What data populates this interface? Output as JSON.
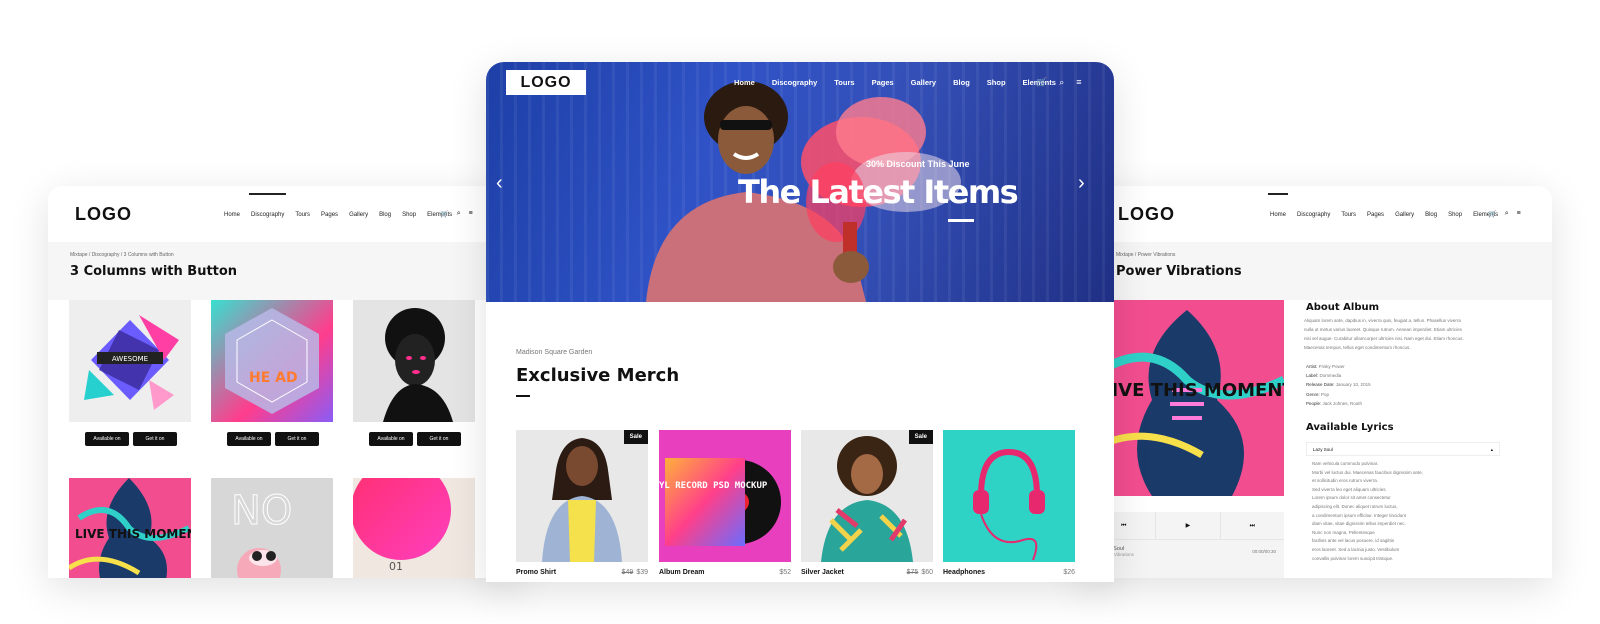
{
  "left": {
    "logo": "LOGO",
    "menu": [
      "Home",
      "Discography",
      "Tours",
      "Pages",
      "Gallery",
      "Blog",
      "Shop",
      "Elements"
    ],
    "breadcrumb": [
      "Mixtape",
      "Discography",
      "3 Columns with Button"
    ],
    "title": "3 Columns with Button",
    "store_itunes": "Available on iTunes",
    "store_google": "Get it on Google play",
    "covers": [
      "AWESOME",
      "HE AD",
      "",
      "NO",
      "01"
    ]
  },
  "center": {
    "logo": "LOGO",
    "menu": [
      "Home",
      "Discography",
      "Tours",
      "Pages",
      "Gallery",
      "Blog",
      "Shop",
      "Elements"
    ],
    "cart_count": "0",
    "hero_kicker": "30% Discount This June",
    "hero_title": "The Latest Items",
    "section_kicker": "Madison Square Garden",
    "section_title": "Exclusive Merch",
    "sale_label": "Sale",
    "vinyl_text": "VINYL RECORD PSD MOCKUP",
    "products": [
      {
        "name": "Promo Shirt",
        "old_price": "$49",
        "price": "$39"
      },
      {
        "name": "Album Dream",
        "old_price": "",
        "price": "$52"
      },
      {
        "name": "Silver Jacket",
        "old_price": "$75",
        "price": "$60"
      },
      {
        "name": "Headphones",
        "old_price": "",
        "price": "$26"
      }
    ]
  },
  "right": {
    "logo": "LOGO",
    "menu": [
      "Home",
      "Discography",
      "Tours",
      "Pages",
      "Gallery",
      "Blog",
      "Shop",
      "Elements"
    ],
    "breadcrumb": [
      "Mixtape",
      "Power Vibrations"
    ],
    "title": "Power Vibrations",
    "about_title": "About Album",
    "about_text": [
      "Aliquam lorem ante, dapibus in, viverra quis, feugiat a, tellus. Phasellus viverra",
      "nulla ut metus varius laoreet. Quisque rutrum. Aenean imperdiet. Etiam ultricies",
      "nisi vel augue. Curabitur ullamcorper ultricies nisi. Nam eget dui. Etiam rhoncus.",
      "Maecenas tempus, tellus eget condimentum rhoncus."
    ],
    "meta": [
      {
        "k": "Artist:",
        "v": "Frisky Power"
      },
      {
        "k": "Label:",
        "v": "Dommedia"
      },
      {
        "k": "Release Date:",
        "v": "January 10, 2015"
      },
      {
        "k": "Genre:",
        "v": "Pop"
      },
      {
        "k": "People:",
        "v": "Jack Johnes, Routh"
      }
    ],
    "lyrics_title": "Available Lyrics",
    "lyrics_item": "Lazy Soul",
    "lyrics_lines": [
      "Nam vehicula commodo pulvinar.",
      "Morbi vel luctus dui. Maecenas faucibus dignissim ante,",
      "et sollicitudin eros rutrum viverra.",
      "Sed viverra leo eget aliquam ultricies.",
      "Lorem ipsum dolor sit amet consectetur",
      "adipiscing elit. Donec aliquet rutrum luctus,",
      "a condimentum ipsum efficitur. Integer tincidunt",
      "diam vitae, vitae dignissim tellus imperdiet nec.",
      "Nunc non magna. Pellentesque",
      "facilisis ante vel lacus posuere, id sagittis",
      "eros laoreet. Sed a lacinia justo. Vestibulum",
      "convallis pulvinar lorem suscipit tristique."
    ],
    "track_name": "Lazy Soul",
    "track_album": "Power Vibrations",
    "track_time": "00:00/00:30",
    "cover_text": "LIVE THIS MOMENT"
  }
}
